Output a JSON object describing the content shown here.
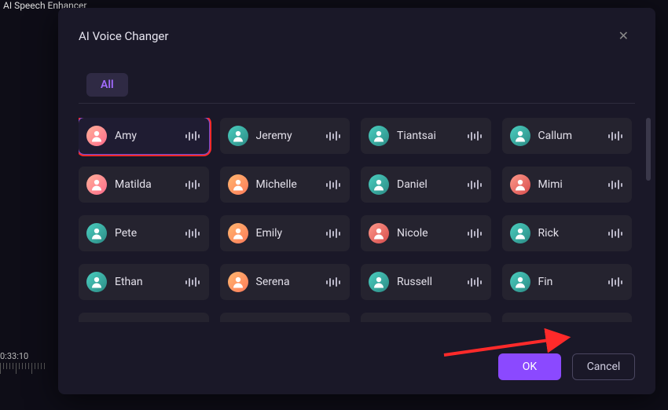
{
  "background": {
    "header_label": "AI Speech Enhancer",
    "timeline_time": "0:33:10"
  },
  "modal": {
    "title": "AI Voice Changer",
    "tabs": {
      "all": "All"
    },
    "buttons": {
      "ok": "OK",
      "cancel": "Cancel"
    }
  },
  "voices": [
    {
      "name": "Amy",
      "avatar": "pink",
      "selected": true,
      "highlighted": true
    },
    {
      "name": "Jeremy",
      "avatar": "teal",
      "selected": false,
      "highlighted": false
    },
    {
      "name": "Tiantsai",
      "avatar": "teal",
      "selected": false,
      "highlighted": false
    },
    {
      "name": "Callum",
      "avatar": "teal",
      "selected": false,
      "highlighted": false
    },
    {
      "name": "Matilda",
      "avatar": "pink",
      "selected": false,
      "highlighted": false
    },
    {
      "name": "Michelle",
      "avatar": "orange",
      "selected": false,
      "highlighted": false
    },
    {
      "name": "Daniel",
      "avatar": "teal",
      "selected": false,
      "highlighted": false
    },
    {
      "name": "Mimi",
      "avatar": "red",
      "selected": false,
      "highlighted": false
    },
    {
      "name": "Pete",
      "avatar": "teal",
      "selected": false,
      "highlighted": false
    },
    {
      "name": "Emily",
      "avatar": "orange",
      "selected": false,
      "highlighted": false
    },
    {
      "name": "Nicole",
      "avatar": "red",
      "selected": false,
      "highlighted": false
    },
    {
      "name": "Rick",
      "avatar": "teal",
      "selected": false,
      "highlighted": false
    },
    {
      "name": "Ethan",
      "avatar": "teal",
      "selected": false,
      "highlighted": false
    },
    {
      "name": "Serena",
      "avatar": "orange",
      "selected": false,
      "highlighted": false
    },
    {
      "name": "Russell",
      "avatar": "teal",
      "selected": false,
      "highlighted": false
    },
    {
      "name": "Fin",
      "avatar": "teal",
      "selected": false,
      "highlighted": false
    }
  ],
  "colors": {
    "accent": "#8b49ff",
    "annotation_red": "#ff2a2a",
    "card_bg": "#25232f",
    "modal_bg": "#1a1828"
  }
}
